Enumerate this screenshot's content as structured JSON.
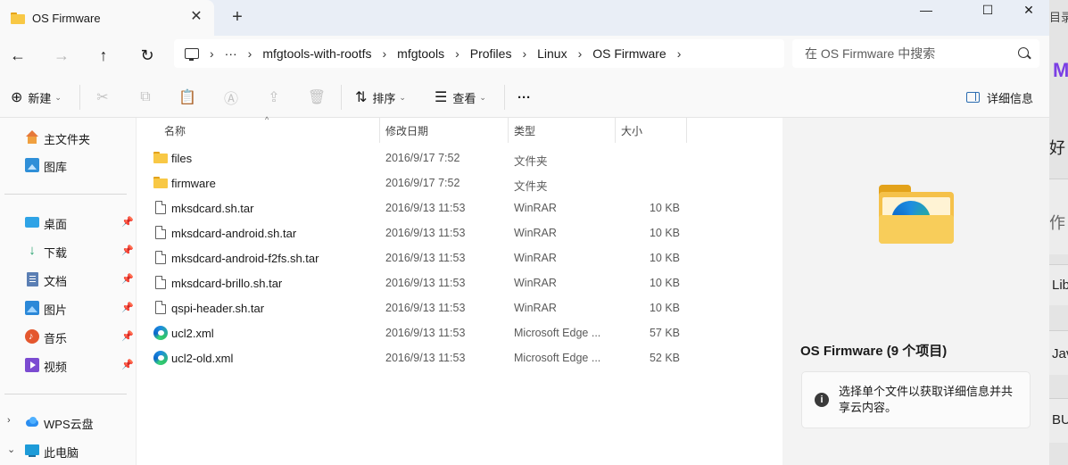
{
  "window": {
    "tab_title": "OS Firmware",
    "tab_close": "✕",
    "new_tab": "+",
    "minimize": "—",
    "maximize": "☐",
    "close": "✕"
  },
  "nav": {
    "back": "←",
    "forward": "→",
    "up": "↑",
    "refresh": "↻"
  },
  "breadcrumb": {
    "more": "···",
    "separator": "›",
    "items": [
      "mfgtools-with-rootfs",
      "mfgtools",
      "Profiles",
      "Linux",
      "OS Firmware"
    ]
  },
  "search": {
    "placeholder": "在 OS Firmware 中搜索"
  },
  "toolbar": {
    "new_label": "新建",
    "sort_label": "排序",
    "view_label": "查看",
    "more_label": "···",
    "details_label": "详细信息"
  },
  "sidebar": {
    "items": [
      {
        "label": "主文件夹"
      },
      {
        "label": "图库"
      },
      {
        "label": "桌面"
      },
      {
        "label": "下载"
      },
      {
        "label": "文档"
      },
      {
        "label": "图片"
      },
      {
        "label": "音乐"
      },
      {
        "label": "视频"
      },
      {
        "label": "WPS云盘"
      },
      {
        "label": "此电脑"
      }
    ],
    "pin": "📌"
  },
  "columns": {
    "name": "名称",
    "date": "修改日期",
    "type": "类型",
    "size": "大小"
  },
  "files": [
    {
      "name": "files",
      "date": "2016/9/17 7:52",
      "type": "文件夹",
      "size": "",
      "icon": "folder"
    },
    {
      "name": "firmware",
      "date": "2016/9/17 7:52",
      "type": "文件夹",
      "size": "",
      "icon": "folder"
    },
    {
      "name": "mksdcard.sh.tar",
      "date": "2016/9/13 11:53",
      "type": "WinRAR",
      "size": "10 KB",
      "icon": "file"
    },
    {
      "name": "mksdcard-android.sh.tar",
      "date": "2016/9/13 11:53",
      "type": "WinRAR",
      "size": "10 KB",
      "icon": "file"
    },
    {
      "name": "mksdcard-android-f2fs.sh.tar",
      "date": "2016/9/13 11:53",
      "type": "WinRAR",
      "size": "10 KB",
      "icon": "file"
    },
    {
      "name": "mksdcard-brillo.sh.tar",
      "date": "2016/9/13 11:53",
      "type": "WinRAR",
      "size": "10 KB",
      "icon": "file"
    },
    {
      "name": "qspi-header.sh.tar",
      "date": "2016/9/13 11:53",
      "type": "WinRAR",
      "size": "10 KB",
      "icon": "file"
    },
    {
      "name": "ucl2.xml",
      "date": "2016/9/13 11:53",
      "type": "Microsoft Edge ...",
      "size": "57 KB",
      "icon": "edge"
    },
    {
      "name": "ucl2-old.xml",
      "date": "2016/9/13 11:53",
      "type": "Microsoft Edge ...",
      "size": "52 KB",
      "icon": "edge"
    }
  ],
  "details": {
    "title": "OS Firmware (9 个项目)",
    "info": "选择单个文件以获取详细信息并共享云内容。",
    "info_icon": "i"
  },
  "background_app": {
    "fragments": [
      "目录",
      "好",
      "作",
      "Lib",
      "Jav",
      "BU"
    ]
  }
}
